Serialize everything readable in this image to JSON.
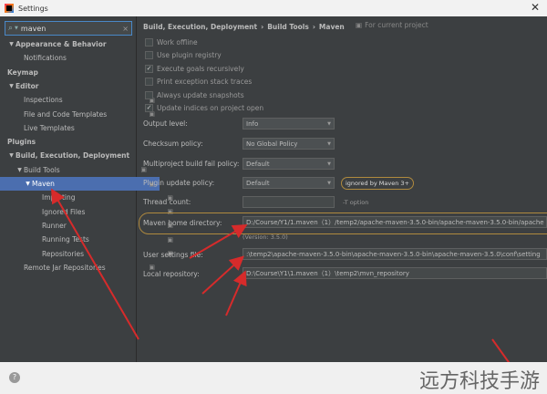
{
  "window": {
    "title": "Settings",
    "close_glyph": "✕"
  },
  "search": {
    "value": "maven",
    "placeholder": "",
    "icon": "search-icon",
    "clear_glyph": "×"
  },
  "sidebar": {
    "items": [
      {
        "label": "Appearance & Behavior",
        "arrow": "▼",
        "bold": true
      },
      {
        "label": "Notifications"
      },
      {
        "label": "Keymap",
        "bold": true
      },
      {
        "label": "Editor",
        "arrow": "▼",
        "bold": true
      },
      {
        "label": "Inspections",
        "project": true
      },
      {
        "label": "File and Code Templates",
        "project": true
      },
      {
        "label": "Live Templates"
      },
      {
        "label": "Plugins",
        "bold": true
      },
      {
        "label": "Build, Execution, Deployment",
        "arrow": "▼",
        "bold": true
      },
      {
        "label": "Build Tools",
        "arrow": "▼",
        "project": true
      },
      {
        "label": "Maven",
        "arrow": "▼",
        "project": true,
        "selected": true
      },
      {
        "label": "Importing",
        "project": true
      },
      {
        "label": "Ignored Files",
        "project": true
      },
      {
        "label": "Runner",
        "project": true
      },
      {
        "label": "Running Tests",
        "project": true
      },
      {
        "label": "Repositories",
        "project": true
      },
      {
        "label": "Remote Jar Repositories",
        "project": true
      }
    ]
  },
  "breadcrumb": {
    "part1": "Build, Execution, Deployment",
    "part2": "Build Tools",
    "part3": "Maven",
    "sep": "›"
  },
  "for_current_project": "For current project",
  "checkboxes": [
    {
      "label": "Work offline",
      "checked": false
    },
    {
      "label": "Use plugin registry",
      "checked": false
    },
    {
      "label": "Execute goals recursively",
      "checked": true
    },
    {
      "label": "Print exception stack traces",
      "checked": false
    },
    {
      "label": "Always update snapshots",
      "checked": false
    },
    {
      "label": "Update indices on project open",
      "checked": true
    }
  ],
  "form": {
    "output_level": {
      "label": "Output level:",
      "value": "Info"
    },
    "checksum_policy": {
      "label": "Checksum policy:",
      "value": "No Global Policy"
    },
    "multiproject_fail": {
      "label": "Multiproject build fail policy:",
      "value": "Default"
    },
    "plugin_update": {
      "label": "Plugin update policy:",
      "value": "Default",
      "tag": "ignored by Maven 3+"
    },
    "thread_count": {
      "label": "Thread count:",
      "value": "",
      "hint": "-T option"
    },
    "maven_home": {
      "label": "Maven home directory:",
      "value": "D:/Course/Y1/1.maven（1）/temp2/apache-maven-3.5.0-bin/apache-maven-3.5.0-bin/apache",
      "version": "(Version: 3.5.0)"
    },
    "user_settings": {
      "label": "User settings file:",
      "value": ":\\temp2\\apache-maven-3.5.0-bin\\apache-maven-3.5.0-bin\\apache-maven-3.5.0\\conf\\setting"
    },
    "local_repo": {
      "label": "Local repository:",
      "value": "D:\\Course\\Y1\\1.maven（1）\\temp2\\mvn_repository"
    }
  },
  "help_glyph": "?",
  "watermark": "远方科技手游",
  "colors": {
    "accent": "#4b6eaf",
    "annotation_red": "#d62b2b",
    "highlight_gold": "#b08a3e"
  }
}
